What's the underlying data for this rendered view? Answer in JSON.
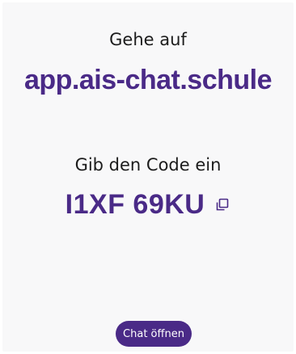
{
  "instructions": {
    "step1": "Gehe auf",
    "url": "app.ais-chat.schule",
    "step2": "Gib den Code ein",
    "code": "I1XF 69KU"
  },
  "actions": {
    "copy_icon": "copy-icon",
    "open_chat_label": "Chat öffnen"
  },
  "colors": {
    "accent": "#4a2a87",
    "background": "#f8f8f9",
    "text": "#1c1c1c"
  }
}
